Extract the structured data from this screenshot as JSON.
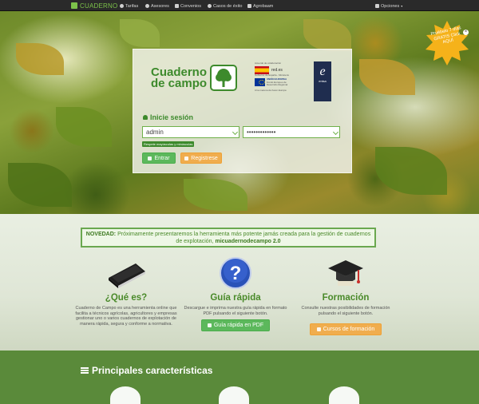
{
  "navbar": {
    "brand": "CUADERNO",
    "items": [
      {
        "label": "Tarifas",
        "icon": "check-icon"
      },
      {
        "label": "Asesores",
        "icon": "users-icon"
      },
      {
        "label": "Convenios",
        "icon": "thumbs-up-icon"
      },
      {
        "label": "Casos de éxito",
        "icon": "globe-icon"
      },
      {
        "label": "Agrobaam",
        "icon": "cart-icon"
      }
    ],
    "options": "Opciones"
  },
  "promo_badge": "Pruébelo 7 días GRATIS Click AQUÍ",
  "login": {
    "brand_title": "Cuaderno de campo",
    "heading": "Inicie sesión",
    "username_value": "admin",
    "password_value": "•••••••••••••",
    "hint": "Respete mayúsculas y minúsculas",
    "enter_label": "Entrar",
    "register_label": "Registrese",
    "sponsors": {
      "line1": "Acuerdo de colaboración",
      "red": "red.es",
      "ministry": "Gobierno de España - Ministerio",
      "eu": "UNIÓN EUROPEA",
      "fund": "Fondo Europeo de Desarrollo Regional",
      "motto": "Una manera de hacer Europa",
      "enisa": "enisa"
    }
  },
  "novedad": {
    "label": "NOVEDAD:",
    "text": "Próximamente presentaremos la herramienta más potente jamás creada para la gestión de cuadernos de explotación,",
    "product": "micuadernodecampo 2.0"
  },
  "columns": [
    {
      "title": "¿Qué es?",
      "text": "Cuaderno de Campo es una herramienta online que facilita a técnicos agrícolas, agricultores y empresas gestionar uno o varios cuadernos de explotación de manera rápida, segura y conforme a normativa."
    },
    {
      "title": "Guía rápida",
      "text": "Descargue e imprima nuestra guía rápida en formato PDF pulsando el siguiente botón.",
      "button": "Guía rápida en PDF"
    },
    {
      "title": "Formación",
      "text": "Consulte nuestras posibilidades de formación pulsando el siguiente botón.",
      "button": "Cursos de formación"
    }
  ],
  "features_title": "Principales características",
  "colors": {
    "green": "#5cb85c",
    "orange": "#f0ad4e",
    "brand_green": "#3d8a2c"
  }
}
